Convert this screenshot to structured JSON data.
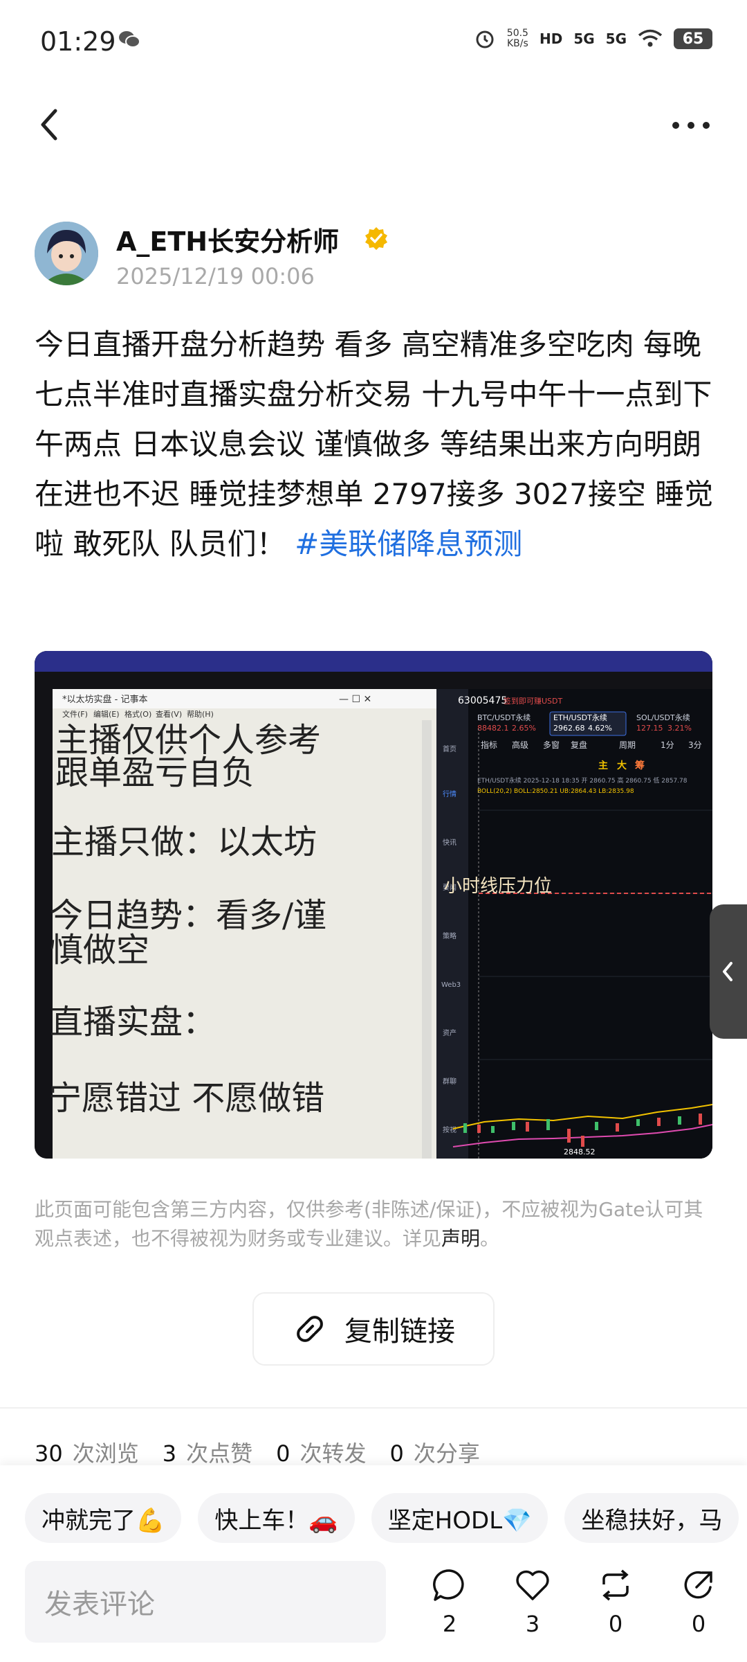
{
  "status_bar": {
    "time": "01:29",
    "net_speed_value": "50.5",
    "net_speed_unit": "KB/s",
    "signal1": "5G",
    "signal2": "5G",
    "hd": "HD",
    "battery": "65"
  },
  "author": {
    "name": "A_ETH长安分析师",
    "time": "2025/12/19 00:06"
  },
  "post": {
    "text": "今日直播开盘分析趋势 看多 高空精准多空吃肉 每晚七点半准时直播实盘分析交易 十九号中午十一点到下午两点 日本议息会议 谨慎做多 等结果出来方向明朗在进也不迟 睡觉挂梦想单 2797接多 3027接空 睡觉啦 敢死队 队员们！ ",
    "hashtag": "#美联储降息预测"
  },
  "image": {
    "notepad_title": "*以太坊实盘 - 记事本",
    "notepad_menu": [
      "文件(F)",
      "编辑(E)",
      "格式(O)",
      "查看(V)",
      "帮助(H)"
    ],
    "lines": [
      "主播仅供个人参考",
      "跟单盈亏自负",
      "主播只做：以太坊",
      "今日趋势：看多/谨",
      "慎做空",
      "直播实盘：",
      "宁愿错过 不愿做错"
    ],
    "account_id": "63005475",
    "account_hint": "签到即可赚USDT",
    "sidebar": [
      "首页",
      "行情",
      "快讯",
      "要闻",
      "策略",
      "Web3",
      "资产",
      "群聊",
      "按视"
    ],
    "tickers": [
      {
        "name": "BTC/USDT永续",
        "price": "88482.1",
        "chg": "2.65%"
      },
      {
        "name": "ETH/USDT永续",
        "price": "2962.68",
        "chg": "4.62%"
      },
      {
        "name": "SOL/USDT永续",
        "price": "127.15",
        "chg": "3.21%"
      }
    ],
    "toolbar": [
      "指标",
      "高级",
      "多窗",
      "复盘",
      "周期",
      "1分",
      "3分"
    ],
    "ohlc_line": "ETH/USDT永续  2025-12-18 18:35  开 2860.75  高 2860.75  低 2857.78",
    "boll_line": "BOLL(20,2)  BOLL:2850.21  UB:2864.43  LB:2835.98",
    "pressure_label": "小时线压力位",
    "low_label": "2848.52",
    "marks": [
      "主",
      "大",
      "筹"
    ]
  },
  "disclaimer": {
    "text": "此页面可能包含第三方内容，仅供参考(非陈述/保证)，不应被视为Gate认可其观点表述，也不得被视为财务或专业建议。详见",
    "link": "声明",
    "end": "。"
  },
  "copy_link": "复制链接",
  "stats": [
    {
      "num": "30",
      "label": "次浏览"
    },
    {
      "num": "3",
      "label": "次点赞"
    },
    {
      "num": "0",
      "label": "次转发"
    },
    {
      "num": "0",
      "label": "次分享"
    }
  ],
  "quick_replies": [
    "冲就完了💪",
    "快上车！🚗",
    "坚定HODL💎",
    "坐稳扶好，马"
  ],
  "comment_placeholder": "发表评论",
  "actions": {
    "comment": "2",
    "like": "3",
    "repost": "0",
    "share": "0"
  }
}
